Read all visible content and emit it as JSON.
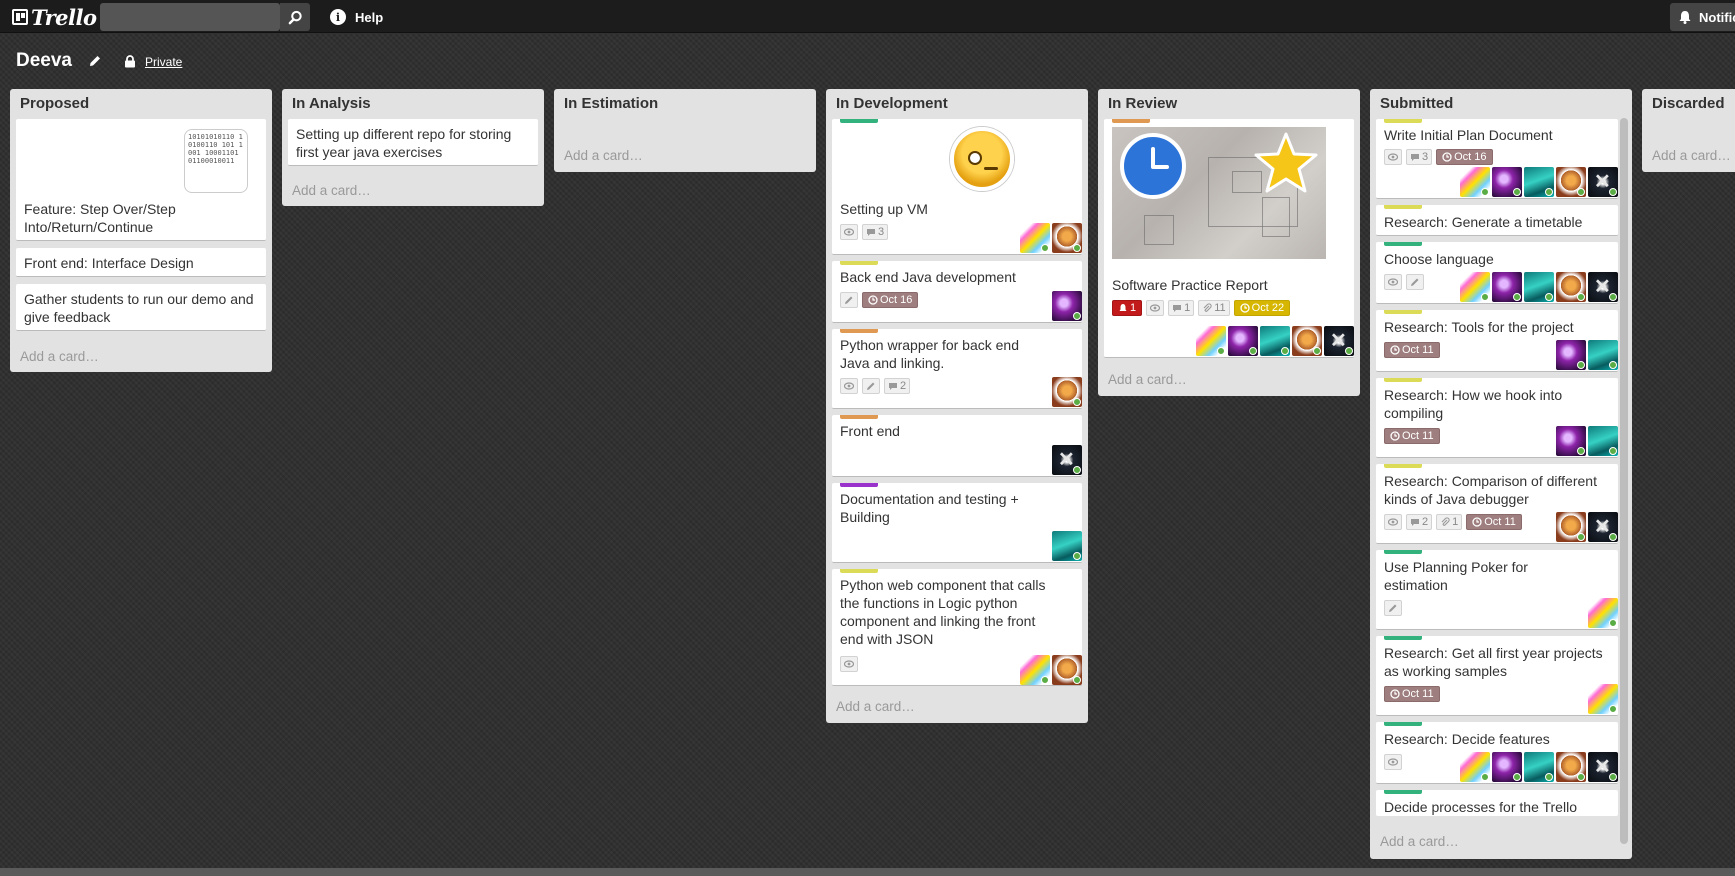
{
  "app": {
    "name": "Trello",
    "search_placeholder": "",
    "help_label": "Help",
    "notifications_label": "Notifications"
  },
  "board": {
    "title": "Deeva",
    "visibility": "Private"
  },
  "colors": {
    "green": "#34b27d",
    "yellow": "#dbdb57",
    "orange": "#e09952",
    "purple": "#9933cc",
    "due_grey": "#9e7e7e",
    "due_yellow": "#d6b600",
    "alert_red": "#c2191a"
  },
  "add_card_label": "Add a card…",
  "lists": [
    {
      "title": "Proposed",
      "cards": [
        {
          "title": "Feature: Step Over/Step Into/Return/Continue",
          "cover": "binary-sticker",
          "cover_text": "10101010110 10100110 101 1001 10001101 01100010011"
        },
        {
          "title": "Front end: Interface Design"
        },
        {
          "title": "Gather students to run our demo and give feedback"
        }
      ]
    },
    {
      "title": "In Analysis",
      "cards": [
        {
          "title": "Setting up different repo for storing first year java exercises"
        }
      ]
    },
    {
      "title": "In Estimation",
      "cards": []
    },
    {
      "title": "In Development",
      "cards": [
        {
          "title": "Setting up VM",
          "label": "green",
          "cover": "worried-emoji",
          "badges": {
            "comments": "3"
          },
          "members": [
            "rainbow",
            "brown"
          ]
        },
        {
          "title": "Back end Java development",
          "label": "yellow",
          "badges": {
            "due": "Oct 16"
          },
          "members": [
            "wizard"
          ]
        },
        {
          "title": "Python wrapper for back end Java and linking.",
          "label": "orange",
          "badges": {
            "comments": "2"
          },
          "members": [
            "brown"
          ]
        },
        {
          "title": "Front end",
          "label": "orange",
          "members": [
            "xwing"
          ]
        },
        {
          "title": "Documentation and testing + Building",
          "label": "purple",
          "members": [
            "teal"
          ]
        },
        {
          "title": "Python web component that calls the functions in Logic python component and linking the front end with JSON",
          "label": "yellow",
          "members": [
            "rainbow",
            "brown"
          ]
        }
      ]
    },
    {
      "title": "In Review",
      "cards": [
        {
          "title": "Software Practice Report",
          "label": "orange",
          "cover": "sketch-photo",
          "badges": {
            "alerts": "1",
            "comments": "1",
            "attachments": "11",
            "due": "Oct 22"
          },
          "members": [
            "rainbow",
            "wizard",
            "teal",
            "brown",
            "xwing"
          ]
        }
      ]
    },
    {
      "title": "Submitted",
      "cards": [
        {
          "title": "Write Initial Plan Document",
          "label": "yellow",
          "badges": {
            "comments": "3",
            "due": "Oct 16"
          },
          "members": [
            "rainbow",
            "wizard",
            "teal",
            "brown",
            "xwing"
          ]
        },
        {
          "title": "Research: Generate a timetable",
          "label": "yellow"
        },
        {
          "title": "Choose language",
          "label": "green",
          "members": [
            "rainbow",
            "wizard",
            "teal",
            "brown",
            "xwing"
          ]
        },
        {
          "title": "Research: Tools for the project",
          "label": "yellow",
          "badges": {
            "due": "Oct 11"
          },
          "members": [
            "wizard",
            "teal"
          ]
        },
        {
          "title": "Research: How we hook into compiling",
          "label": "yellow",
          "badges": {
            "due": "Oct 11"
          },
          "members": [
            "wizard",
            "teal"
          ]
        },
        {
          "title": "Research: Comparison of different kinds of Java debugger",
          "label": "yellow",
          "badges": {
            "comments": "2",
            "attachments": "1",
            "due": "Oct 11"
          },
          "members": [
            "brown",
            "xwing"
          ]
        },
        {
          "title": "Use Planning Poker for estimation",
          "label": "green",
          "members": [
            "rainbow"
          ]
        },
        {
          "title": "Research: Get all first year projects as working samples",
          "label": "green",
          "badges": {
            "due": "Oct 11"
          },
          "members": [
            "rainbow"
          ]
        },
        {
          "title": "Research: Decide features",
          "label": "green",
          "members": [
            "rainbow",
            "wizard",
            "teal",
            "brown",
            "xwing"
          ]
        },
        {
          "title": "Decide processes for the Trello",
          "label": "green"
        }
      ]
    },
    {
      "title": "Discarded",
      "cards": []
    }
  ]
}
